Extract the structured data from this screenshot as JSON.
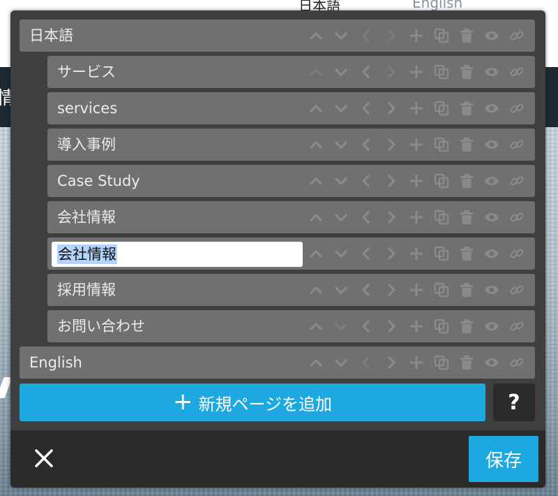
{
  "background": {
    "lang_ja": "日本語",
    "lang_en": "English",
    "nav_fragment": "情"
  },
  "tree": {
    "rows": [
      {
        "label": "日本語",
        "level": "top"
      },
      {
        "label": "サービス",
        "level": "sub"
      },
      {
        "label": "services",
        "level": "sub"
      },
      {
        "label": "導入事例",
        "level": "sub"
      },
      {
        "label": "Case Study",
        "level": "sub"
      },
      {
        "label": "会社情報",
        "level": "sub"
      },
      {
        "label": "会社情報",
        "level": "sub",
        "editing": true
      },
      {
        "label": "採用情報",
        "level": "sub"
      },
      {
        "label": "お問い合わせ",
        "level": "sub"
      },
      {
        "label": "English",
        "level": "top"
      }
    ],
    "row_icons": [
      "chevron-up-icon",
      "chevron-down-icon",
      "chevron-left-icon",
      "chevron-right-icon",
      "plus-icon",
      "duplicate-icon",
      "trash-icon",
      "eye-icon",
      "link-icon"
    ]
  },
  "actions": {
    "add_page_label": "新規ページを追加",
    "add_page_icon": "+",
    "help_label": "?",
    "save_label": "保存",
    "close_icon": "close-icon"
  },
  "colors": {
    "modal_bg": "#3f3f3f",
    "row_bg": "#707070",
    "accent": "#1ea8e0",
    "footer_bg": "#2a2a2a"
  }
}
